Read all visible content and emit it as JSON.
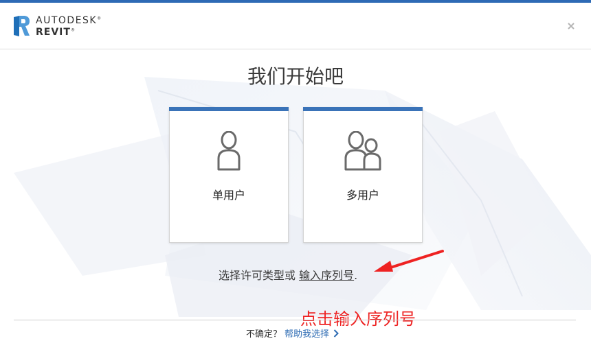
{
  "header": {
    "brand": "AUTODESK",
    "product": "REVIT"
  },
  "icons": {
    "close": "close-icon",
    "single_user": "single-user-icon",
    "multi_user": "multi-user-icon",
    "chevron": "chevron-right-icon",
    "arrow": "annotation-arrow-icon"
  },
  "main": {
    "title": "我们开始吧",
    "cards": [
      {
        "label": "单用户"
      },
      {
        "label": "多用户"
      }
    ],
    "license_prefix": "选择许可类型或",
    "license_link": "输入序列号",
    "license_suffix": "."
  },
  "annotation": {
    "text": "点击输入序列号"
  },
  "footer": {
    "question": "不确定？",
    "help_link": "帮助我选择"
  },
  "colors": {
    "accent": "#3a73b8",
    "link": "#2d6bb3",
    "annotation": "#ee2222"
  }
}
